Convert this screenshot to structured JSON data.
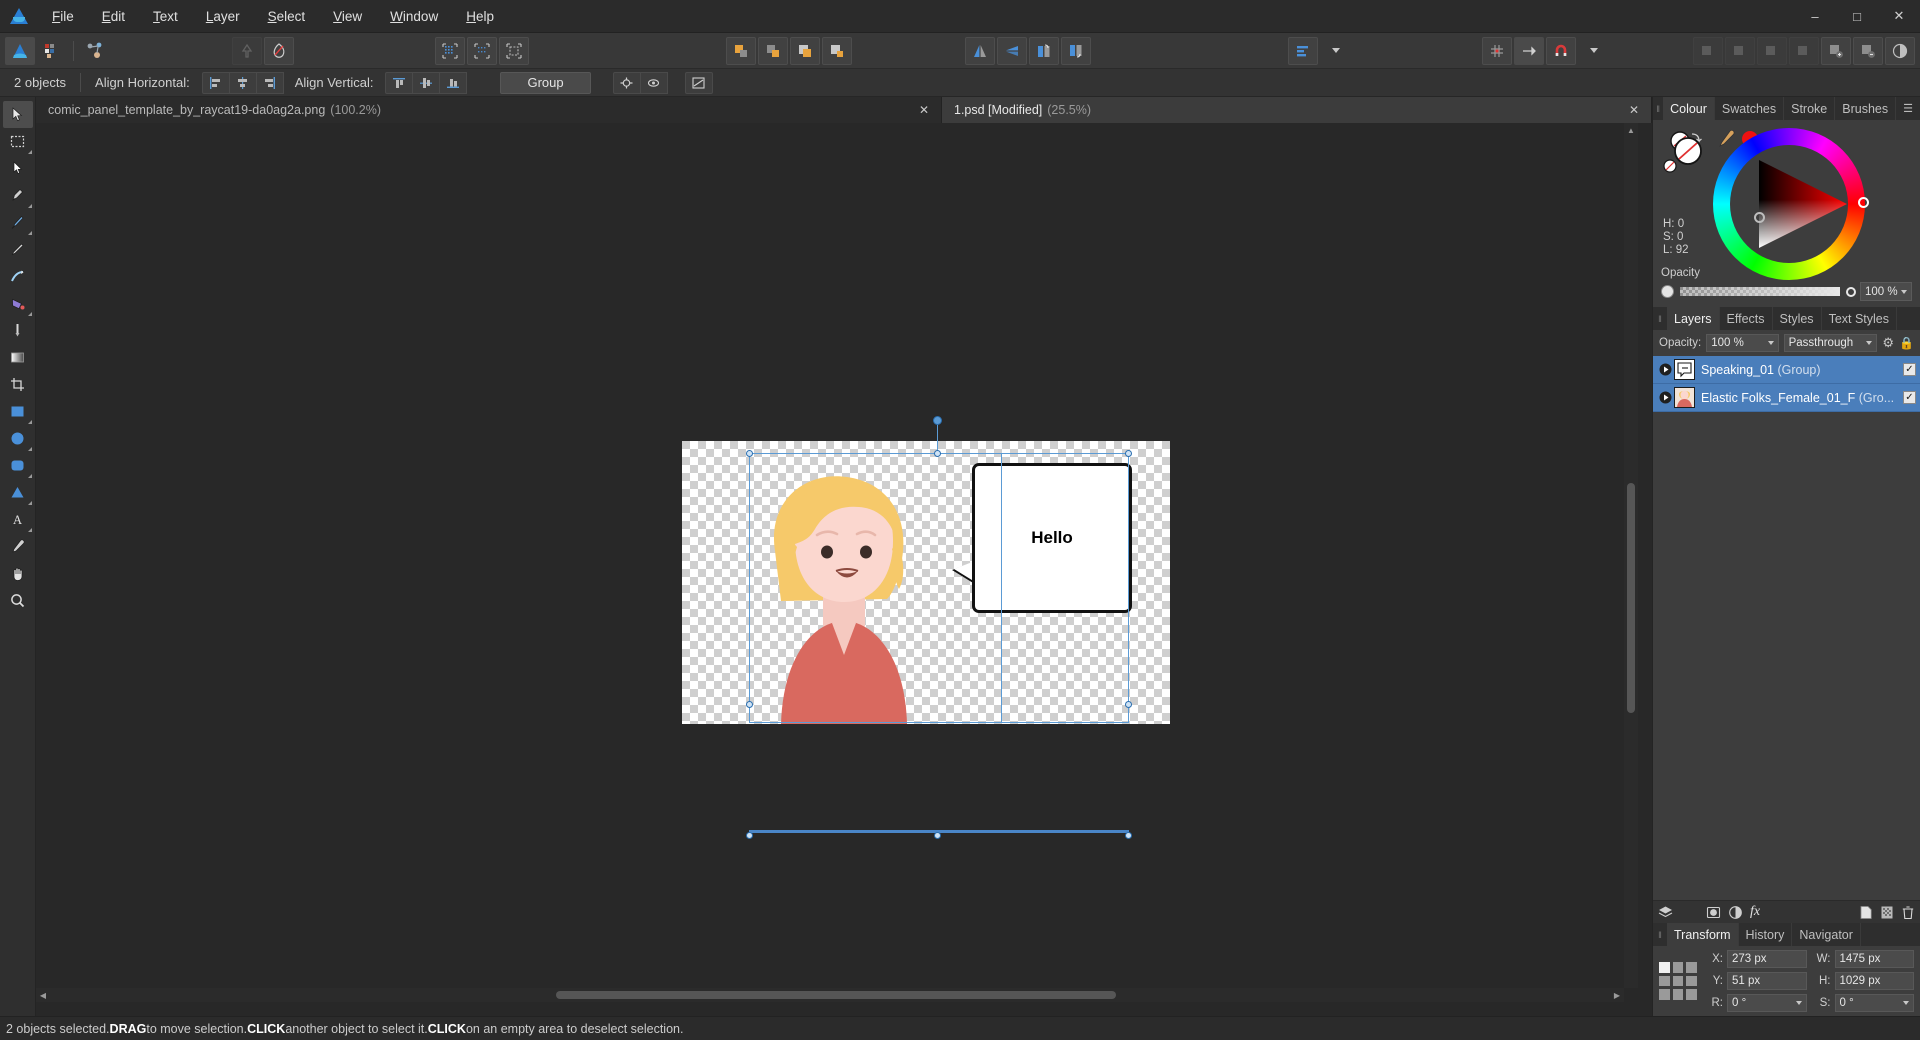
{
  "app": {
    "logo_icon": "affinity-logo-icon",
    "window_controls": {
      "minimize": "–",
      "maximize": "□",
      "close": "✕"
    }
  },
  "menu": {
    "items": [
      {
        "label": "File",
        "accel": "F"
      },
      {
        "label": "Edit",
        "accel": "E"
      },
      {
        "label": "Text",
        "accel": "T"
      },
      {
        "label": "Layer",
        "accel": "L"
      },
      {
        "label": "Select",
        "accel": "S"
      },
      {
        "label": "View",
        "accel": "V"
      },
      {
        "label": "Window",
        "accel": "W"
      },
      {
        "label": "Help",
        "accel": "H"
      }
    ]
  },
  "toolbar": {
    "buttons": [
      "persona-photo-icon",
      "persona-liquify-icon",
      "persona-export-icon",
      "undo-icon",
      "redo-icon",
      "pixel-selection-icon",
      "refine-selection-icon",
      "selection-from-layer-icon",
      "move-front-icon",
      "move-forward-icon",
      "move-backward-icon",
      "move-back-icon",
      "flip-horizontal-icon",
      "flip-vertical-icon",
      "rotate-left-icon",
      "rotate-right-icon",
      "alignment-icon",
      "alignment-dropdown-caret",
      "show-grid-icon",
      "show-snapping-axis-icon",
      "snapping-magnet-icon",
      "snapping-caret",
      "zoom-out-icon",
      "zoom-in-icon",
      "toggle-ui-icon",
      "split-view-icon",
      "preview-mode-icon"
    ]
  },
  "context_bar": {
    "selection_count": "2 objects",
    "align_horizontal_label": "Align Horizontal:",
    "align_horizontal_buttons": [
      "align-left-icon",
      "align-center-horizontal-icon",
      "align-right-icon"
    ],
    "align_vertical_label": "Align Vertical:",
    "align_vertical_buttons": [
      "align-top-icon",
      "align-center-vertical-icon",
      "align-bottom-icon"
    ],
    "align_to_label": "Group",
    "extra_buttons": [
      "align-to-target-icon",
      "hide-align-icon",
      "distribute-icon"
    ]
  },
  "tools": {
    "items": [
      {
        "icon": "move-tool-icon",
        "selected": true,
        "has_submenu": false
      },
      {
        "icon": "marquee-select-tool-icon",
        "selected": false,
        "has_submenu": true
      },
      {
        "icon": "node-tool-icon",
        "selected": false,
        "has_submenu": false
      },
      {
        "icon": "pen-tool-icon",
        "selected": false,
        "has_submenu": true
      },
      {
        "icon": "paint-brush-tool-icon",
        "selected": false,
        "has_submenu": true
      },
      {
        "icon": "pencil-tool-icon",
        "selected": false,
        "has_submenu": false
      },
      {
        "icon": "vector-brush-tool-icon",
        "selected": false,
        "has_submenu": false
      },
      {
        "icon": "fill-tool-icon",
        "selected": false,
        "has_submenu": true
      },
      {
        "icon": "colour-picker-tool-icon",
        "selected": false,
        "has_submenu": false
      },
      {
        "icon": "gradient-tool-icon",
        "selected": false,
        "has_submenu": false
      },
      {
        "icon": "crop-tool-icon",
        "selected": false,
        "has_submenu": false
      },
      {
        "icon": "rectangle-tool-icon",
        "selected": false,
        "has_submenu": true
      },
      {
        "icon": "ellipse-tool-icon",
        "selected": false,
        "has_submenu": true
      },
      {
        "icon": "rounded-rectangle-tool-icon",
        "selected": false,
        "has_submenu": true
      },
      {
        "icon": "triangle-tool-icon",
        "selected": false,
        "has_submenu": true
      },
      {
        "icon": "artistic-text-tool-icon",
        "selected": false,
        "has_submenu": true
      },
      {
        "icon": "eyedropper-tool-icon",
        "selected": false,
        "has_submenu": false
      },
      {
        "icon": "view-pan-tool-icon",
        "selected": false,
        "has_submenu": false
      },
      {
        "icon": "zoom-tool-icon",
        "selected": false,
        "has_submenu": false
      }
    ]
  },
  "document_tabs": [
    {
      "title": "comic_panel_template_by_raycat19-da0ag2a.png",
      "zoom": "(100.2%)",
      "active": false,
      "close": "✕"
    },
    {
      "title": "1.psd [Modified]",
      "zoom": "(25.5%)",
      "active": true,
      "close": "✕"
    }
  ],
  "canvas": {
    "speech_bubble_text": "Hello"
  },
  "colour_panel": {
    "tabs": [
      {
        "label": "Colour",
        "active": true
      },
      {
        "label": "Swatches",
        "active": false
      },
      {
        "label": "Stroke",
        "active": false
      },
      {
        "label": "Brushes",
        "active": false
      }
    ],
    "menu_icon": "panel-menu-icon",
    "eyedropper_icon": "eyedropper-icon",
    "current_colour": "#ee1111",
    "readouts": {
      "h": "H: 0",
      "s": "S: 0",
      "l": "L: 92"
    },
    "opacity_label": "Opacity",
    "opacity_value": "100 %"
  },
  "layers_panel": {
    "tabs": [
      {
        "label": "Layers",
        "active": true
      },
      {
        "label": "Effects",
        "active": false
      },
      {
        "label": "Styles",
        "active": false
      },
      {
        "label": "Text Styles",
        "active": false
      }
    ],
    "opacity_label": "Opacity:",
    "opacity_value": "100 %",
    "blend_mode": "Passthrough",
    "settings_icon": "gear-icon",
    "lock_icon": "lock-icon",
    "rows": [
      {
        "name": "Speaking_01",
        "kind": "(Group)",
        "thumb": "speech-bubble-thumb",
        "visible": true,
        "selected": true
      },
      {
        "name": "Elastic Folks_Female_01_F",
        "kind": "(Gro...",
        "thumb": "character-thumb",
        "visible": true,
        "selected": true
      }
    ],
    "footer_icons": [
      "layer-stack-icon",
      "adjustment-icon",
      "live-filter-icon",
      "fx-icon",
      "add-layer-icon",
      "add-mask-icon",
      "delete-layer-icon"
    ],
    "fx_label": "fx"
  },
  "transform_panel": {
    "tabs": [
      {
        "label": "Transform",
        "active": true
      },
      {
        "label": "History",
        "active": false
      },
      {
        "label": "Navigator",
        "active": false
      }
    ],
    "fields": [
      {
        "label": "X:",
        "value": "273 px"
      },
      {
        "label": "W:",
        "value": "1475 px"
      },
      {
        "label": "Y:",
        "value": "51 px"
      },
      {
        "label": "H:",
        "value": "1029 px"
      },
      {
        "label": "R:",
        "value": "0 °"
      },
      {
        "label": "S:",
        "value": "0 °"
      }
    ]
  },
  "status_bar": {
    "parts": [
      {
        "text": "2 objects selected. ",
        "bold": false
      },
      {
        "text": "DRAG",
        "bold": true
      },
      {
        "text": " to move selection. ",
        "bold": false
      },
      {
        "text": "CLICK",
        "bold": true
      },
      {
        "text": " another object to select it. ",
        "bold": false
      },
      {
        "text": "CLICK",
        "bold": true
      },
      {
        "text": " on an empty area to deselect selection.",
        "bold": false
      }
    ],
    "full_text": "2 objects selected. DRAG to move selection. CLICK another object to select it. CLICK on an empty area to deselect selection."
  }
}
